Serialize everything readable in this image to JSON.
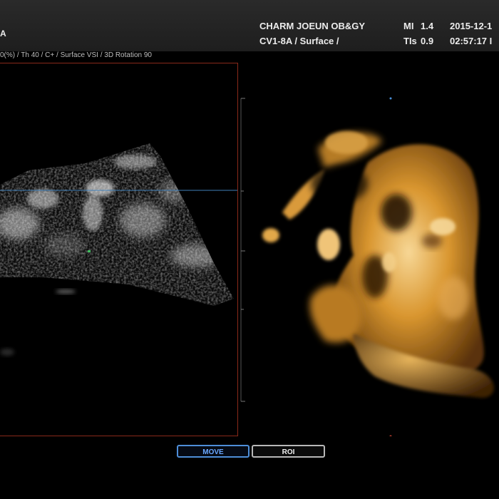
{
  "header": {
    "left_label": "A",
    "clinic": "CHARM JOEUN OB&GY",
    "probe": "CV1-8A / Surface /",
    "mi_label": "MI",
    "mi_value": "1.4",
    "tis_label": "TIs",
    "tis_value": "0.9",
    "date": "2015-12-1",
    "time": "02:57:17 I"
  },
  "params": "0(%) / Th 40 / C+ / Surface VSI / 3D Rotation 90",
  "buttons": {
    "move": "MOVE",
    "roi": "ROI"
  },
  "colors": {
    "header_bg": "#242424",
    "frame_border": "#8a2a1a",
    "cursor_line": "#3f7fb8",
    "render_gold": "#c98a2a",
    "move_active": "#4e8ed8"
  }
}
